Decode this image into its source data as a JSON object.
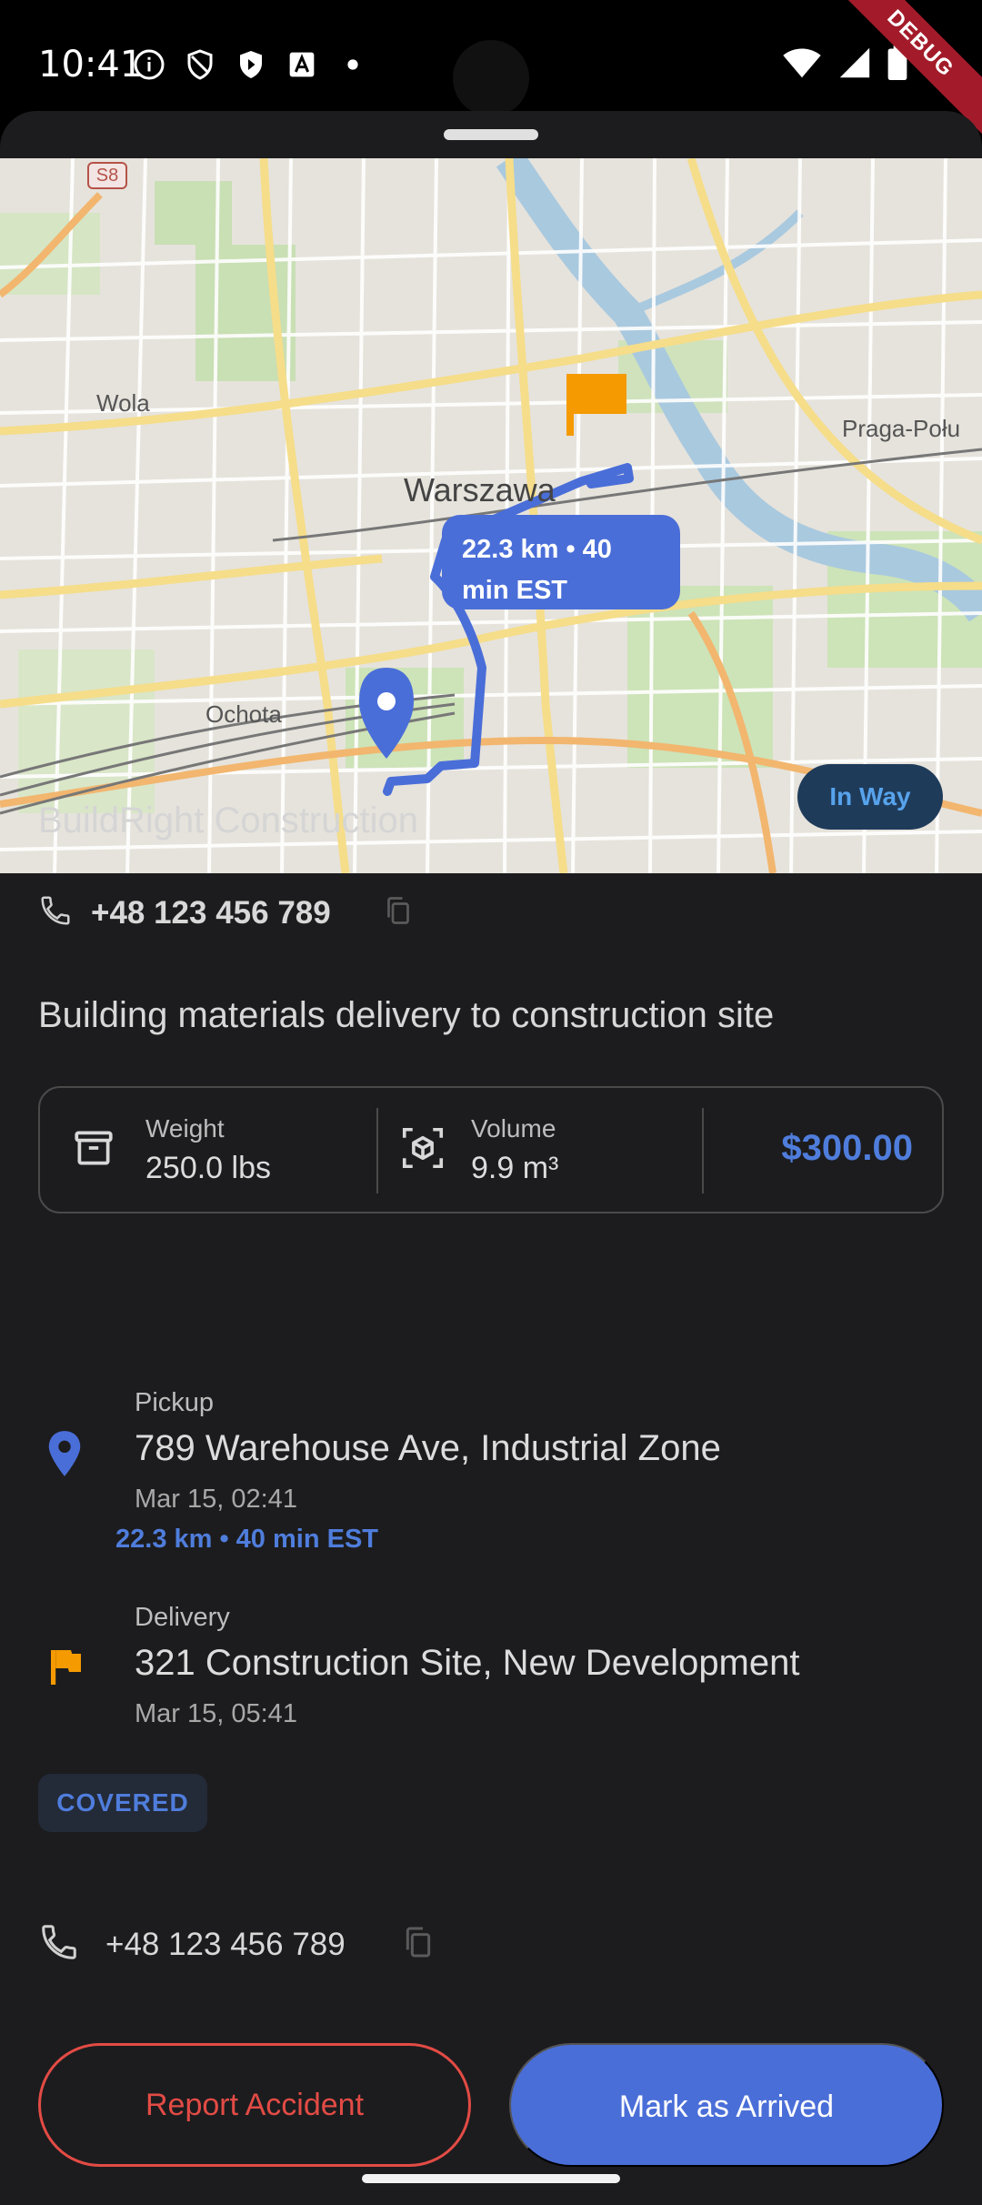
{
  "status_bar": {
    "time": "10:41",
    "debug_label": "DEBUG",
    "left_icons": [
      "info-icon",
      "shield-icon",
      "play-protect-icon",
      "a-icon",
      "dot-icon"
    ],
    "right_icons": [
      "wifi-icon",
      "signal-icon",
      "battery-icon"
    ]
  },
  "map": {
    "labels": {
      "warszawa": "Warszawa",
      "wola": "Wola",
      "ochota": "Ochota",
      "praga": "Praga-Połu",
      "s8": "S8"
    },
    "route_bubble": {
      "line1": "22.3 km • 40",
      "line2": "min EST"
    },
    "colors": {
      "route": "#4a6ed8",
      "pickup_pin": "#4a6ed8",
      "flag": "#f59a00"
    }
  },
  "order": {
    "status": "In Way",
    "company": "BuildRight Construction",
    "phone": "+48 123 456 789",
    "description": "Building materials delivery to construction site",
    "weight": {
      "label": "Weight",
      "value": "250.0 lbs"
    },
    "volume": {
      "label": "Volume",
      "value": "9.9 m³"
    },
    "price": "$300.00",
    "pickup": {
      "label": "Pickup",
      "address": "789 Warehouse Ave, Industrial Zone",
      "time": "Mar 15, 02:41",
      "route": "22.3 km • 40 min EST"
    },
    "delivery": {
      "label": "Delivery",
      "address": "321 Construction Site, New Development",
      "time": "Mar 15, 05:41"
    },
    "tag": "COVERED",
    "contact_phone": "+48 123 456 789"
  },
  "actions": {
    "report": "Report Accident",
    "arrive": "Mark as Arrived"
  }
}
